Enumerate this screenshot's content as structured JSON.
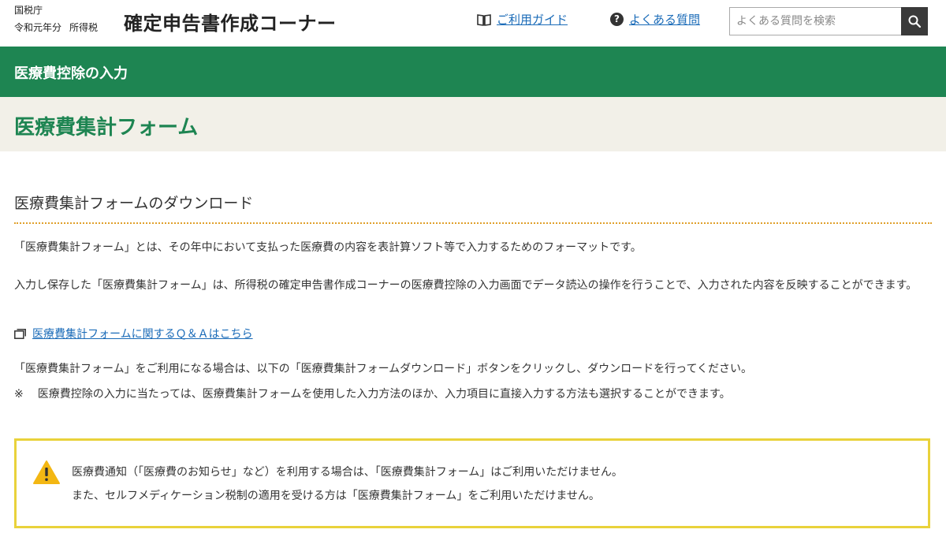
{
  "header": {
    "agency": "国税庁",
    "era": "令和元年分",
    "tax_type": "所得税",
    "title": "確定申告書作成コーナー",
    "guide_link": "ご利用ガイド",
    "faq_link": "よくある質問",
    "search": {
      "placeholder": "よくある質問を検索"
    }
  },
  "icons": {
    "guide": "book-icon",
    "faq": "question-circle-icon",
    "search": "magnifier-icon",
    "qa_link": "window-icon",
    "warning": "warning-triangle-icon"
  },
  "colors": {
    "brand_green": "#1e8552",
    "title_bg": "#f2f0e8",
    "link": "#1a6bb8",
    "warning_border": "#e9d23b",
    "divider": "#e0a02b"
  },
  "section": {
    "label": "医療費控除の入力"
  },
  "page": {
    "title": "医療費集計フォーム"
  },
  "content": {
    "heading": "医療費集計フォームのダウンロード",
    "para1": "「医療費集計フォーム」とは、その年中において支払った医療費の内容を表計算ソフト等で入力するためのフォーマットです。",
    "para2": "入力し保存した「医療費集計フォーム」は、所得税の確定申告書作成コーナーの医療費控除の入力画面でデータ読込の操作を行うことで、入力された内容を反映することができます。",
    "qa_link": "医療費集計フォームに関するＱ＆Ａはこちら",
    "para3": "「医療費集計フォーム」をご利用になる場合は、以下の「医療費集計フォームダウンロード」ボタンをクリックし、ダウンロードを行ってください。",
    "note_mark": "※",
    "note": "医療費控除の入力に当たっては、医療費集計フォームを使用した入力方法のほか、入力項目に直接入力する方法も選択することができます。",
    "warning": {
      "line1": "医療費通知（「医療費のお知らせ」など）を利用する場合は、「医療費集計フォーム」はご利用いただけません。",
      "line2": "また、セルフメディケーション税制の適用を受ける方は「医療費集計フォーム」をご利用いただけません。"
    }
  }
}
